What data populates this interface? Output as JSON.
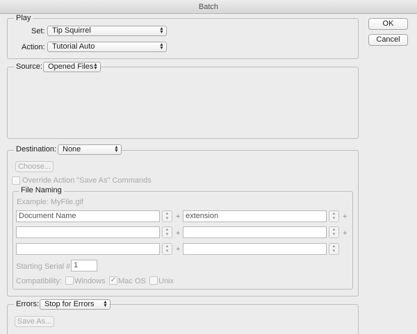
{
  "window": {
    "title": "Batch"
  },
  "buttons": {
    "ok": "OK",
    "cancel": "Cancel"
  },
  "play": {
    "group_title": "Play",
    "set_label": "Set:",
    "set_value": "Tip Squirrel",
    "action_label": "Action:",
    "action_value": "Tutorial Auto"
  },
  "source": {
    "label": "Source:",
    "value": "Opened Files"
  },
  "destination": {
    "label": "Destination:",
    "value": "None",
    "choose_button": "Choose...",
    "override_label": "Override Action \"Save As\" Commands"
  },
  "file_naming": {
    "group_title": "File Naming",
    "example": "Example: MyFile.gif",
    "fields": [
      {
        "left": "Document Name",
        "right": "extension"
      },
      {
        "left": "",
        "right": ""
      },
      {
        "left": "",
        "right": ""
      }
    ],
    "plus": "+",
    "serial_label": "Starting Serial #:",
    "serial_value": "1",
    "compat_label": "Compatibility:",
    "compat_windows": "Windows",
    "compat_macos": "Mac OS",
    "compat_unix": "Unix"
  },
  "errors": {
    "label": "Errors:",
    "value": "Stop for Errors",
    "save_as_button": "Save As..."
  },
  "icons": {
    "popup": "updown-arrows-icon",
    "stepper": "stepper-icon",
    "check": "checkmark-icon"
  }
}
